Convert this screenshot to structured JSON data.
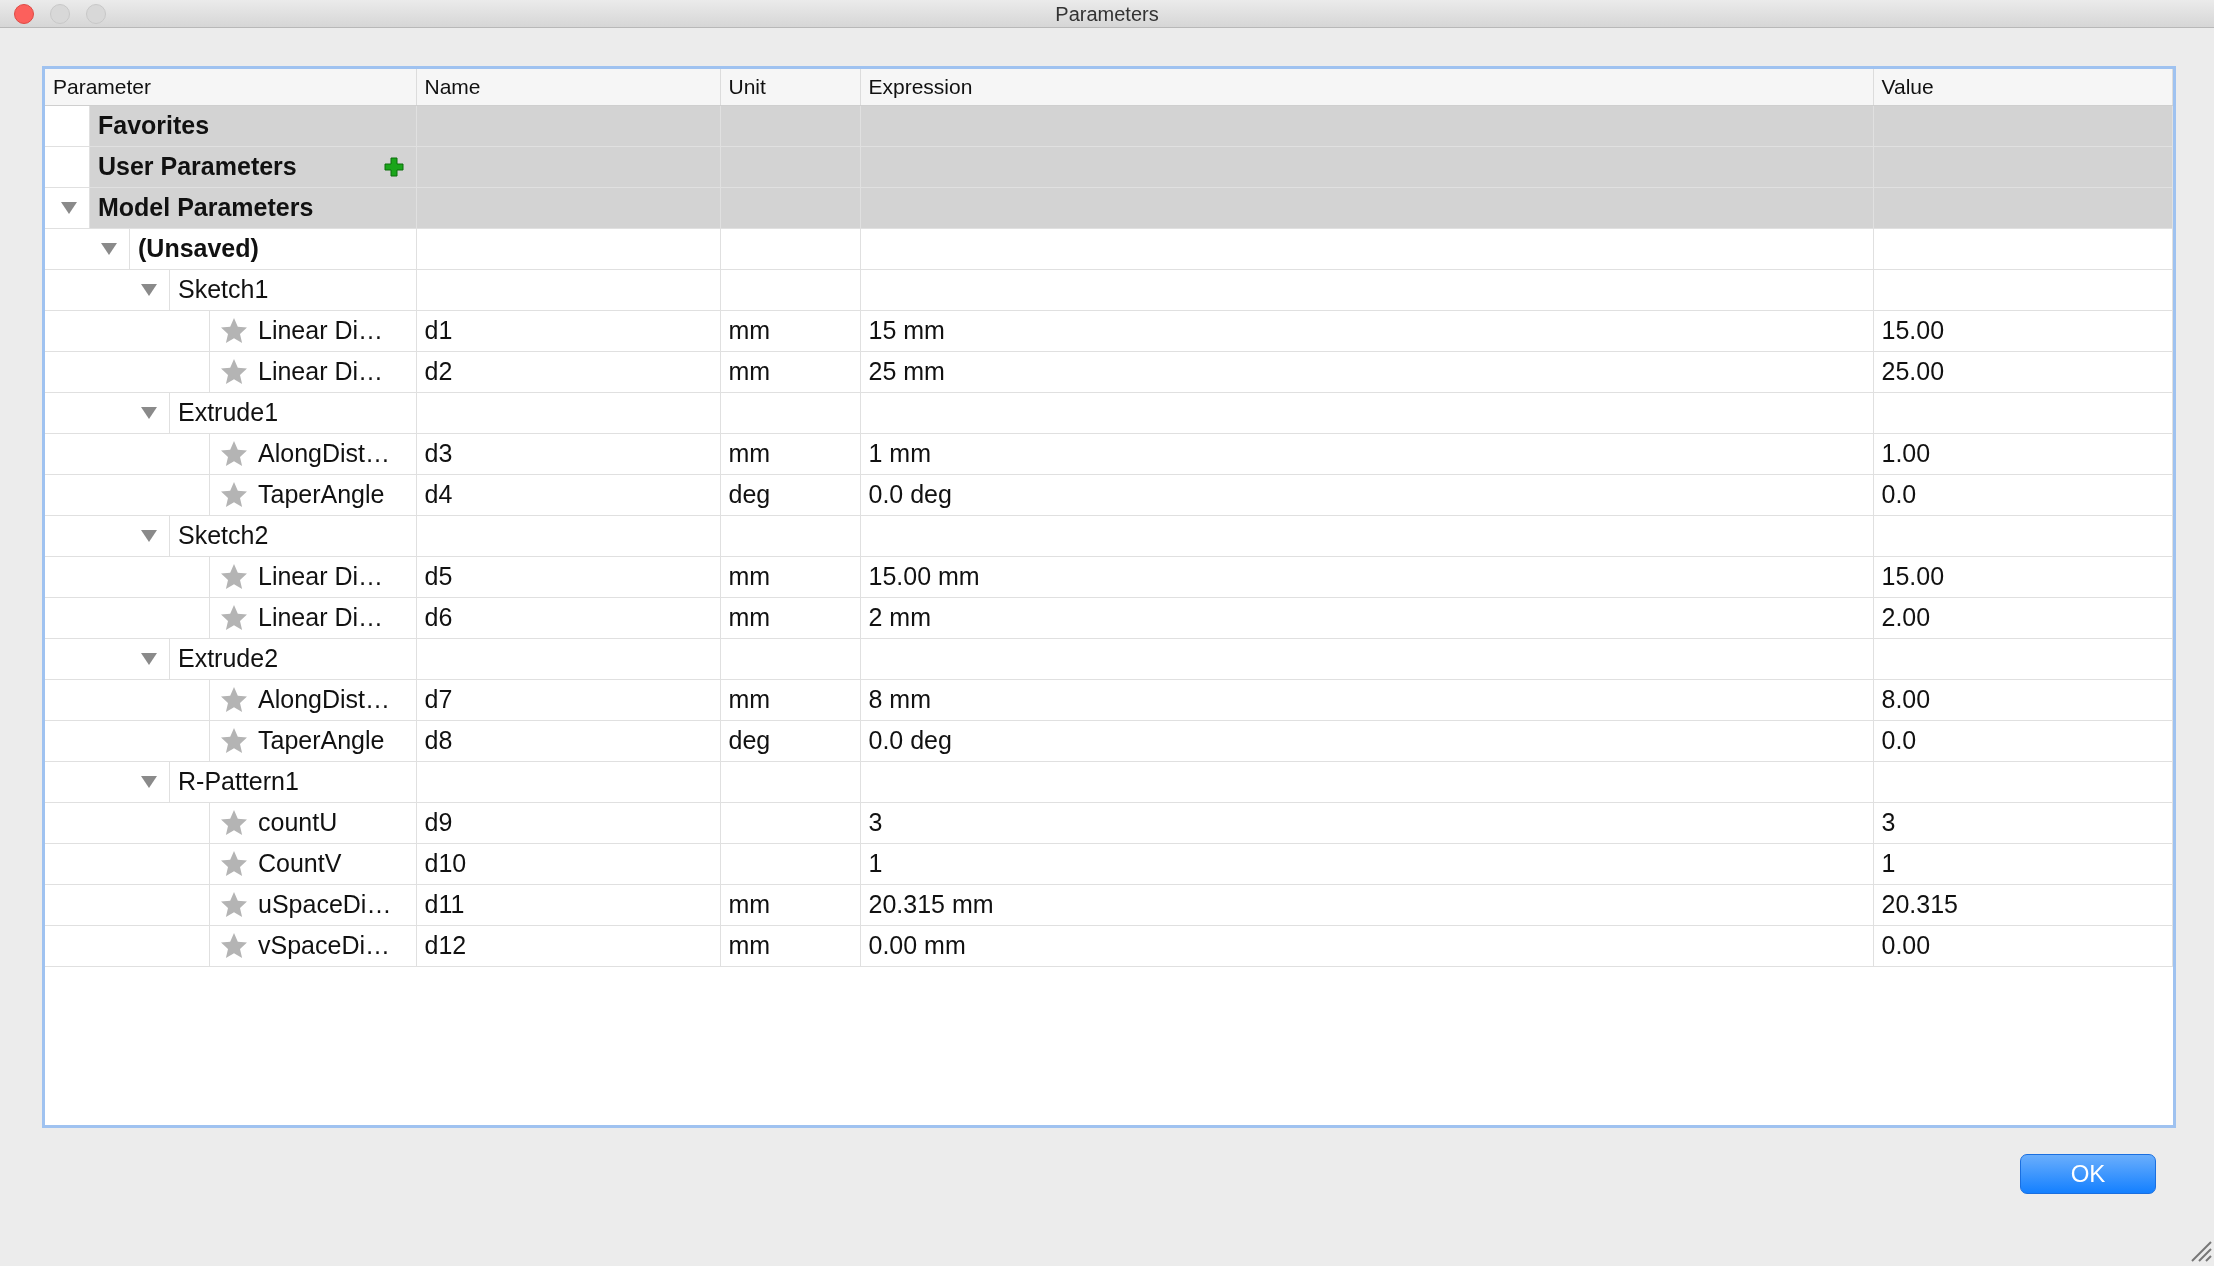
{
  "window": {
    "title": "Parameters"
  },
  "table": {
    "columns": [
      "Parameter",
      "Name",
      "Unit",
      "Expression",
      "Value"
    ],
    "tree": [
      {
        "kind": "category",
        "label": "Favorites"
      },
      {
        "kind": "category",
        "label": "User Parameters",
        "add_button": true
      },
      {
        "kind": "category",
        "label": "Model Parameters",
        "expanded": true,
        "children": [
          {
            "kind": "document",
            "label": "(Unsaved)",
            "expanded": true,
            "children": [
              {
                "kind": "feature",
                "label": "Sketch1",
                "expanded": true,
                "children": [
                  {
                    "kind": "parameter",
                    "label": "Linear Di…",
                    "favorite": false,
                    "name": "d1",
                    "unit": "mm",
                    "expression": "15 mm",
                    "value": "15.00"
                  },
                  {
                    "kind": "parameter",
                    "label": "Linear Di…",
                    "favorite": false,
                    "name": "d2",
                    "unit": "mm",
                    "expression": "25 mm",
                    "value": "25.00"
                  }
                ]
              },
              {
                "kind": "feature",
                "label": "Extrude1",
                "expanded": true,
                "children": [
                  {
                    "kind": "parameter",
                    "label": "AlongDist…",
                    "favorite": false,
                    "name": "d3",
                    "unit": "mm",
                    "expression": "1 mm",
                    "value": "1.00"
                  },
                  {
                    "kind": "parameter",
                    "label": "TaperAngle",
                    "favorite": false,
                    "name": "d4",
                    "unit": "deg",
                    "expression": "0.0 deg",
                    "value": "0.0"
                  }
                ]
              },
              {
                "kind": "feature",
                "label": "Sketch2",
                "expanded": true,
                "children": [
                  {
                    "kind": "parameter",
                    "label": "Linear Di…",
                    "favorite": false,
                    "name": "d5",
                    "unit": "mm",
                    "expression": "15.00 mm",
                    "value": "15.00"
                  },
                  {
                    "kind": "parameter",
                    "label": "Linear Di…",
                    "favorite": false,
                    "name": "d6",
                    "unit": "mm",
                    "expression": "2 mm",
                    "value": "2.00"
                  }
                ]
              },
              {
                "kind": "feature",
                "label": "Extrude2",
                "expanded": true,
                "children": [
                  {
                    "kind": "parameter",
                    "label": "AlongDist…",
                    "favorite": false,
                    "name": "d7",
                    "unit": "mm",
                    "expression": "8 mm",
                    "value": "8.00"
                  },
                  {
                    "kind": "parameter",
                    "label": "TaperAngle",
                    "favorite": false,
                    "name": "d8",
                    "unit": "deg",
                    "expression": "0.0 deg",
                    "value": "0.0"
                  }
                ]
              },
              {
                "kind": "feature",
                "label": "R-Pattern1",
                "expanded": true,
                "children": [
                  {
                    "kind": "parameter",
                    "label": "countU",
                    "favorite": false,
                    "name": "d9",
                    "expression": "3",
                    "value": "3"
                  },
                  {
                    "kind": "parameter",
                    "label": "CountV",
                    "favorite": false,
                    "name": "d10",
                    "expression": "1",
                    "value": "1"
                  },
                  {
                    "kind": "parameter",
                    "label": "uSpaceDi…",
                    "favorite": false,
                    "name": "d11",
                    "unit": "mm",
                    "expression": "20.315 mm",
                    "value": "20.315"
                  },
                  {
                    "kind": "parameter",
                    "label": "vSpaceDi…",
                    "favorite": false,
                    "name": "d12",
                    "unit": "mm",
                    "expression": "0.00 mm",
                    "value": "0.00"
                  }
                ]
              }
            ]
          }
        ]
      }
    ]
  },
  "buttons": [
    {
      "label": "OK",
      "default": true
    }
  ]
}
